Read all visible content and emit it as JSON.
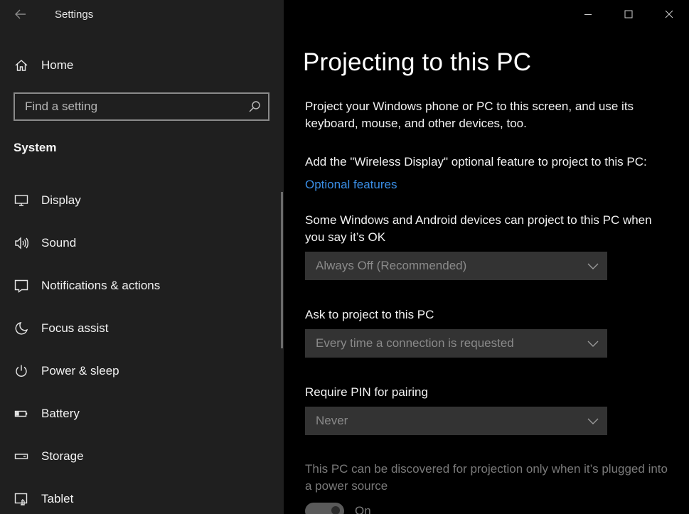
{
  "app": {
    "title": "Settings"
  },
  "sidebar": {
    "home_label": "Home",
    "search_placeholder": "Find a setting",
    "section": "System",
    "items": [
      {
        "label": "Display",
        "icon": "monitor-icon"
      },
      {
        "label": "Sound",
        "icon": "speaker-icon"
      },
      {
        "label": "Notifications & actions",
        "icon": "notification-icon"
      },
      {
        "label": "Focus assist",
        "icon": "moon-icon"
      },
      {
        "label": "Power & sleep",
        "icon": "power-icon"
      },
      {
        "label": "Battery",
        "icon": "battery-icon"
      },
      {
        "label": "Storage",
        "icon": "storage-icon"
      },
      {
        "label": "Tablet",
        "icon": "tablet-icon"
      }
    ]
  },
  "main": {
    "title": "Projecting to this PC",
    "description": "Project your Windows phone or PC to this screen, and use its keyboard, mouse, and other devices, too.",
    "feature_text": "Add the \"Wireless Display\" optional feature to project to this PC:",
    "feature_link": "Optional features",
    "allow_text": "Some Windows and Android devices can project to this PC when you say it’s OK",
    "allow_value": "Always Off (Recommended)",
    "ask_label": "Ask to project to this PC",
    "ask_value": "Every time a connection is requested",
    "pin_label": "Require PIN for pairing",
    "pin_value": "Never",
    "power_text": "This PC can be discovered for projection only when it’s plugged into a power source",
    "power_toggle": "On"
  }
}
